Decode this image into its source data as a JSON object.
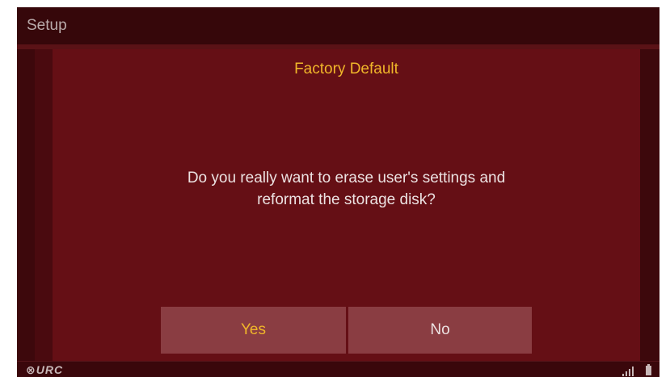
{
  "header": {
    "title": "Setup"
  },
  "dialog": {
    "title": "Factory Default",
    "message_line1": "Do you really want to erase user's settings and",
    "message_line2": "reformat the storage disk?",
    "yes_label": "Yes",
    "no_label": "No"
  },
  "footer": {
    "logo_text": "⊗URC",
    "signal_icon": "signal-bars-icon",
    "battery_icon": "battery-icon"
  },
  "colors": {
    "accent": "#f0b62a",
    "dialog_bg": "#650f15",
    "button_bg": "#8a3d42",
    "text": "#ece2e2"
  }
}
